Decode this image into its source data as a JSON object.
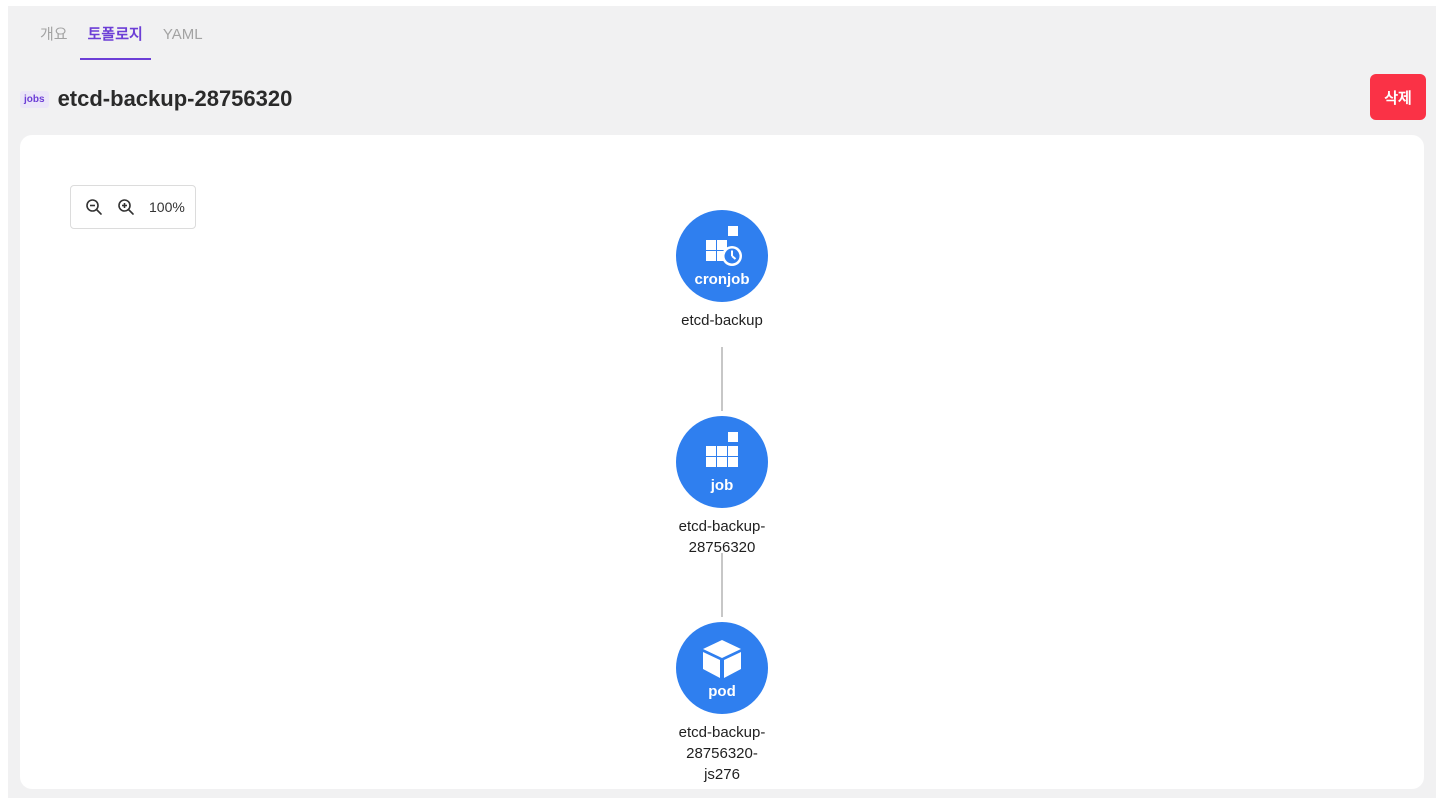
{
  "tabs": [
    {
      "label": "개요",
      "active": false
    },
    {
      "label": "토폴로지",
      "active": true
    },
    {
      "label": "YAML",
      "active": false
    }
  ],
  "resource": {
    "kind_badge": "jobs",
    "name": "etcd-backup-28756320"
  },
  "actions": {
    "delete_label": "삭제"
  },
  "zoom": {
    "level": "100%",
    "zoom_out_icon": "zoom-out-icon",
    "zoom_in_icon": "zoom-in-icon"
  },
  "topology": {
    "nodes": [
      {
        "type": "cronjob",
        "name": "etcd-backup",
        "icon": "cronjob-icon"
      },
      {
        "type": "job",
        "name": "etcd-backup-28756320",
        "icon": "job-icon"
      },
      {
        "type": "pod",
        "name": "etcd-backup-28756320-js276",
        "icon": "pod-icon"
      }
    ]
  },
  "colors": {
    "accent": "#6c3ed6",
    "node": "#2f7fef",
    "danger": "#fa3246",
    "background": "#f1f1f2"
  }
}
